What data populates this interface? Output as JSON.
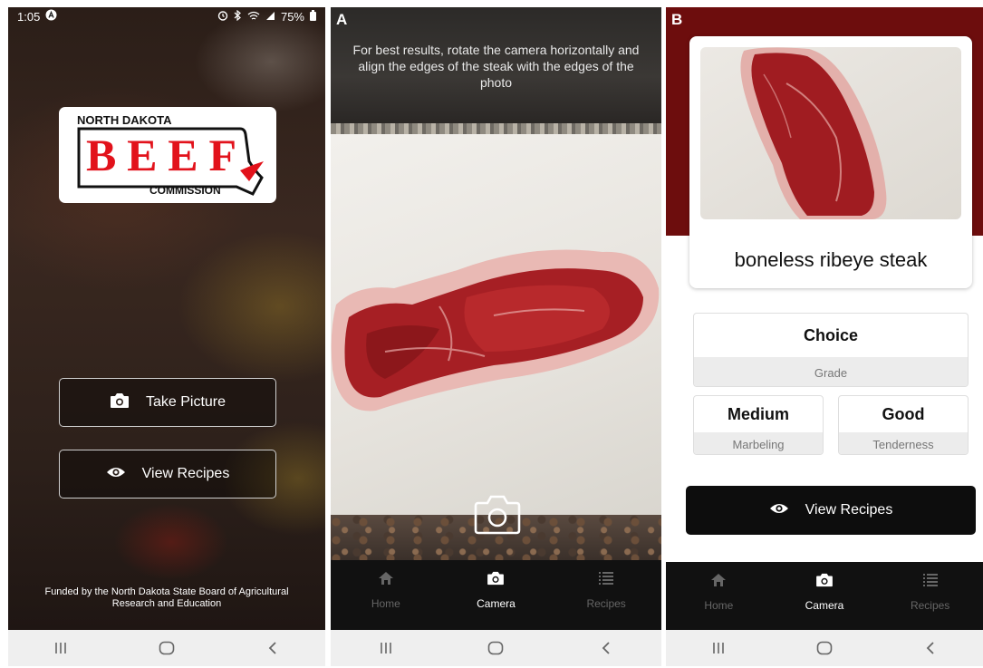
{
  "home": {
    "status": {
      "time": "1:05",
      "battery": "75%"
    },
    "logo": {
      "line1": "NORTH DAKOTA",
      "line2": "BEEF",
      "line3": "COMMISSION"
    },
    "take_picture_label": "Take Picture",
    "view_recipes_label": "View Recipes",
    "funded_text": "Funded by the North Dakota State Board of Agricultural Research and Education"
  },
  "camera": {
    "panel_letter": "A",
    "instructions": "For best results, rotate the camera horizontally and align the edges of the steak with the edges of the photo"
  },
  "result": {
    "panel_letter": "B",
    "cut_name": "boneless ribeye steak",
    "grade_value": "Choice",
    "grade_label": "Grade",
    "marbling_value": "Medium",
    "marbling_label": "Marbeling",
    "tenderness_value": "Good",
    "tenderness_label": "Tenderness",
    "view_recipes_label": "View Recipes"
  },
  "app_nav": {
    "tabs": [
      {
        "label": "Home",
        "icon": "home-icon"
      },
      {
        "label": "Camera",
        "icon": "camera-icon"
      },
      {
        "label": "Recipes",
        "icon": "list-icon"
      }
    ],
    "active": "Camera"
  },
  "system_nav": {
    "icons": [
      "recents-icon",
      "home-circle-icon",
      "back-icon"
    ]
  },
  "colors": {
    "brand_red": "#e2121b",
    "banner": "#6d0d0d",
    "nav_dark": "#111111"
  }
}
